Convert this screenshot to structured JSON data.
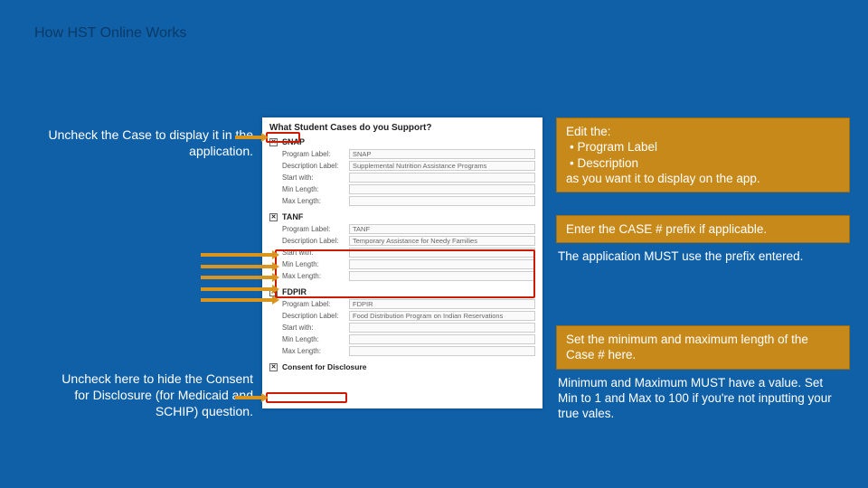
{
  "slide": {
    "title": "How HST Online Works"
  },
  "leftNotes": {
    "uncheck_case": "Uncheck the Case to display it in the application.",
    "uncheck_consent": "Uncheck here to hide the Consent for Disclosure (for Medicaid and SCHIP) question."
  },
  "form": {
    "heading": "What Student Cases do you Support?",
    "labels": {
      "program_label": "Program Label:",
      "description_label": "Description Label:",
      "start_with": "Start with:",
      "min_length": "Min Length:",
      "max_length": "Max Length:"
    },
    "cases": [
      {
        "name": "SNAP",
        "checked": true,
        "program_label": "SNAP",
        "description_label": "Supplemental Nutrition Assistance Programs",
        "start_with": "",
        "min_length": "",
        "max_length": ""
      },
      {
        "name": "TANF",
        "checked": true,
        "program_label": "TANF",
        "description_label": "Temporary Assistance for Needy Families",
        "start_with": "",
        "min_length": "",
        "max_length": ""
      },
      {
        "name": "FDPIR",
        "checked": true,
        "program_label": "FDPIR",
        "description_label": "Food Distribution Program on Indian Reservations",
        "start_with": "",
        "min_length": "",
        "max_length": ""
      }
    ],
    "consent": {
      "label": "Consent for Disclosure",
      "checked": true
    }
  },
  "callouts": {
    "c1": {
      "boxed_lines": [
        "Edit the:",
        "•    Program Label",
        "•    Description",
        "as you want it to display on the app."
      ]
    },
    "c2": {
      "boxed": "Enter the CASE # prefix if applicable.",
      "plain": "The application MUST use the prefix entered."
    },
    "c3": {
      "boxed": "Set the minimum and maximum length of the Case # here.",
      "plain": "Minimum and Maximum MUST have a value. Set Min to 1 and Max to 100 if you're not inputting your true vales."
    }
  }
}
